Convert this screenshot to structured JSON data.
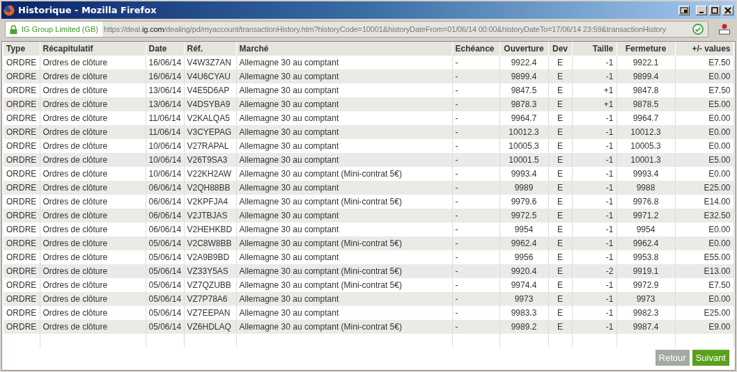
{
  "window": {
    "title": "Historique - Mozilla Firefox"
  },
  "address_bar": {
    "identity": "IG Group Limited (GB)",
    "url_prefix": "https://deal.",
    "url_domain": "ig.com",
    "url_rest": "/dealing/pd/myaccount/transactionHistory.htm?historyCode=10001&historyDateFrom=01/06/14 00:00&historyDateTo=17/06/14 23:59&transactionHistory"
  },
  "table": {
    "columns": [
      {
        "label": "Type"
      },
      {
        "label": "Récapitulatif"
      },
      {
        "label": "Date"
      },
      {
        "label": "Réf."
      },
      {
        "label": "Marché"
      },
      {
        "label": "Echéance"
      },
      {
        "label": "Ouverture"
      },
      {
        "label": "Dev"
      },
      {
        "label": "Taille"
      },
      {
        "label": "Fermeture"
      },
      {
        "label": "+/- values"
      }
    ],
    "rows": [
      [
        "ORDRE",
        "Ordres de clôture",
        "16/06/14",
        "V4W3Z7AN",
        "Allemagne 30 au comptant",
        "-",
        "9922.4",
        "E",
        "-1",
        "9922.1",
        "E7.50"
      ],
      [
        "ORDRE",
        "Ordres de clôture",
        "16/06/14",
        "V4U6CYAU",
        "Allemagne 30 au comptant",
        "-",
        "9899.4",
        "E",
        "-1",
        "9899.4",
        "E0.00"
      ],
      [
        "ORDRE",
        "Ordres de clôture",
        "13/06/14",
        "V4E5D6AP",
        "Allemagne 30 au comptant",
        "-",
        "9847.5",
        "E",
        "+1",
        "9847.8",
        "E7.50"
      ],
      [
        "ORDRE",
        "Ordres de clôture",
        "13/06/14",
        "V4DSYBA9",
        "Allemagne 30 au comptant",
        "-",
        "9878.3",
        "E",
        "+1",
        "9878.5",
        "E5.00"
      ],
      [
        "ORDRE",
        "Ordres de clôture",
        "11/06/14",
        "V2KALQA5",
        "Allemagne 30 au comptant",
        "-",
        "9964.7",
        "E",
        "-1",
        "9964.7",
        "E0.00"
      ],
      [
        "ORDRE",
        "Ordres de clôture",
        "11/06/14",
        "V3CYEPAG",
        "Allemagne 30 au comptant",
        "-",
        "10012.3",
        "E",
        "-1",
        "10012.3",
        "E0.00"
      ],
      [
        "ORDRE",
        "Ordres de clôture",
        "10/06/14",
        "V27RAPAL",
        "Allemagne 30 au comptant",
        "-",
        "10005.3",
        "E",
        "-1",
        "10005.3",
        "E0.00"
      ],
      [
        "ORDRE",
        "Ordres de clôture",
        "10/06/14",
        "V26T9SA3",
        "Allemagne 30 au comptant",
        "-",
        "10001.5",
        "E",
        "-1",
        "10001.3",
        "E5.00"
      ],
      [
        "ORDRE",
        "Ordres de clôture",
        "10/06/14",
        "V22KH2AW",
        "Allemagne 30 au comptant (Mini-contrat 5€)",
        "-",
        "9993.4",
        "E",
        "-1",
        "9993.4",
        "E0.00"
      ],
      [
        "ORDRE",
        "Ordres de clôture",
        "06/06/14",
        "V2QH88BB",
        "Allemagne 30 au comptant",
        "-",
        "9989",
        "E",
        "-1",
        "9988",
        "E25.00"
      ],
      [
        "ORDRE",
        "Ordres de clôture",
        "06/06/14",
        "V2KPFJA4",
        "Allemagne 30 au comptant (Mini-contrat 5€)",
        "-",
        "9979.6",
        "E",
        "-1",
        "9976.8",
        "E14.00"
      ],
      [
        "ORDRE",
        "Ordres de clôture",
        "06/06/14",
        "V2JTBJAS",
        "Allemagne 30 au comptant",
        "-",
        "9972.5",
        "E",
        "-1",
        "9971.2",
        "E32.50"
      ],
      [
        "ORDRE",
        "Ordres de clôture",
        "06/06/14",
        "V2HEHKBD",
        "Allemagne 30 au comptant",
        "-",
        "9954",
        "E",
        "-1",
        "9954",
        "E0.00"
      ],
      [
        "ORDRE",
        "Ordres de clôture",
        "05/06/14",
        "V2C8W8BB",
        "Allemagne 30 au comptant (Mini-contrat 5€)",
        "-",
        "9962.4",
        "E",
        "-1",
        "9962.4",
        "E0.00"
      ],
      [
        "ORDRE",
        "Ordres de clôture",
        "05/06/14",
        "V2A9B9BD",
        "Allemagne 30 au comptant",
        "-",
        "9956",
        "E",
        "-1",
        "9953.8",
        "E55.00"
      ],
      [
        "ORDRE",
        "Ordres de clôture",
        "05/06/14",
        "VZ33Y5AS",
        "Allemagne 30 au comptant (Mini-contrat 5€)",
        "-",
        "9920.4",
        "E",
        "-2",
        "9919.1",
        "E13.00"
      ],
      [
        "ORDRE",
        "Ordres de clôture",
        "05/06/14",
        "VZ7QZUBB",
        "Allemagne 30 au comptant (Mini-contrat 5€)",
        "-",
        "9974.4",
        "E",
        "-1",
        "9972.9",
        "E7.50"
      ],
      [
        "ORDRE",
        "Ordres de clôture",
        "05/06/14",
        "VZ7P78A6",
        "Allemagne 30 au comptant",
        "-",
        "9973",
        "E",
        "-1",
        "9973",
        "E0.00"
      ],
      [
        "ORDRE",
        "Ordres de clôture",
        "05/06/14",
        "VZ7EEPAN",
        "Allemagne 30 au comptant",
        "-",
        "9983.3",
        "E",
        "-1",
        "9982.3",
        "E25.00"
      ],
      [
        "ORDRE",
        "Ordres de clôture",
        "05/06/14",
        "VZ6HDLAQ",
        "Allemagne 30 au comptant (Mini-contrat 5€)",
        "-",
        "9989.2",
        "E",
        "-1",
        "9987.4",
        "E9.00"
      ]
    ]
  },
  "buttons": [
    {
      "label": "Retour",
      "disabled": true
    },
    {
      "label": "Suivant",
      "disabled": false
    }
  ]
}
